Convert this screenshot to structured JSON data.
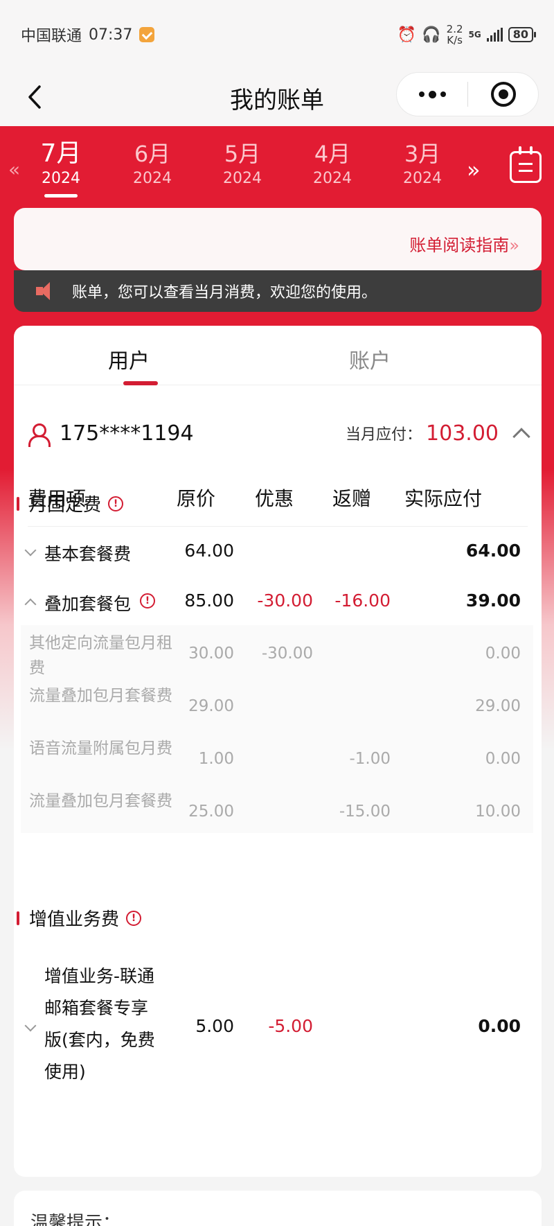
{
  "status_bar": {
    "carrier": "中国联通",
    "time": "07:37",
    "speed_value": "2.2",
    "speed_unit": "K/s",
    "network": "5G",
    "battery": "80"
  },
  "nav": {
    "title": "我的账单"
  },
  "months": [
    {
      "month": "7月",
      "year": "2024",
      "active": true
    },
    {
      "month": "6月",
      "year": "2024"
    },
    {
      "month": "5月",
      "year": "2024"
    },
    {
      "month": "4月",
      "year": "2024"
    },
    {
      "month": "3月",
      "year": "2024"
    }
  ],
  "guide": {
    "link": "账单阅读指南"
  },
  "notice": {
    "text": "账单，您可以查看当月消费，欢迎您的使用。"
  },
  "tabs": [
    {
      "label": "用户",
      "active": true
    },
    {
      "label": "账户"
    }
  ],
  "user": {
    "phone": "175****1194",
    "due_label": "当月应付：",
    "due_amount": "103.00"
  },
  "table": {
    "headers": [
      "费用项",
      "原价",
      "优惠",
      "返赠",
      "实际应付"
    ],
    "sections": [
      {
        "title": "月固定费",
        "rows": [
          {
            "name": "基本套餐费",
            "orig": "64.00",
            "disc": "",
            "gift": "",
            "actual": "64.00"
          },
          {
            "name": "叠加套餐包",
            "orig": "85.00",
            "disc": "-30.00",
            "gift": "-16.00",
            "actual": "39.00"
          }
        ],
        "sub_rows": [
          {
            "name": "其他定向流量包月租费",
            "orig": "30.00",
            "disc": "-30.00",
            "gift": "",
            "actual": "0.00"
          },
          {
            "name": "流量叠加包月套餐费",
            "orig": "29.00",
            "disc": "",
            "gift": "",
            "actual": "29.00"
          },
          {
            "name": "语音流量附属包月费",
            "orig": "1.00",
            "disc": "",
            "gift": "-1.00",
            "actual": "0.00"
          },
          {
            "name": "流量叠加包月套餐费",
            "orig": "25.00",
            "disc": "",
            "gift": "-15.00",
            "actual": "10.00"
          }
        ]
      },
      {
        "title": "增值业务费",
        "rows": [
          {
            "name": "增值业务-联通邮箱套餐专享版(套内，免费使用)",
            "orig": "5.00",
            "disc": "-5.00",
            "gift": "",
            "actual": "0.00"
          }
        ]
      }
    ]
  },
  "tips": {
    "title": "温馨提示："
  },
  "colors": {
    "brand_red": "#e21c33",
    "accent": "#d31d33"
  }
}
